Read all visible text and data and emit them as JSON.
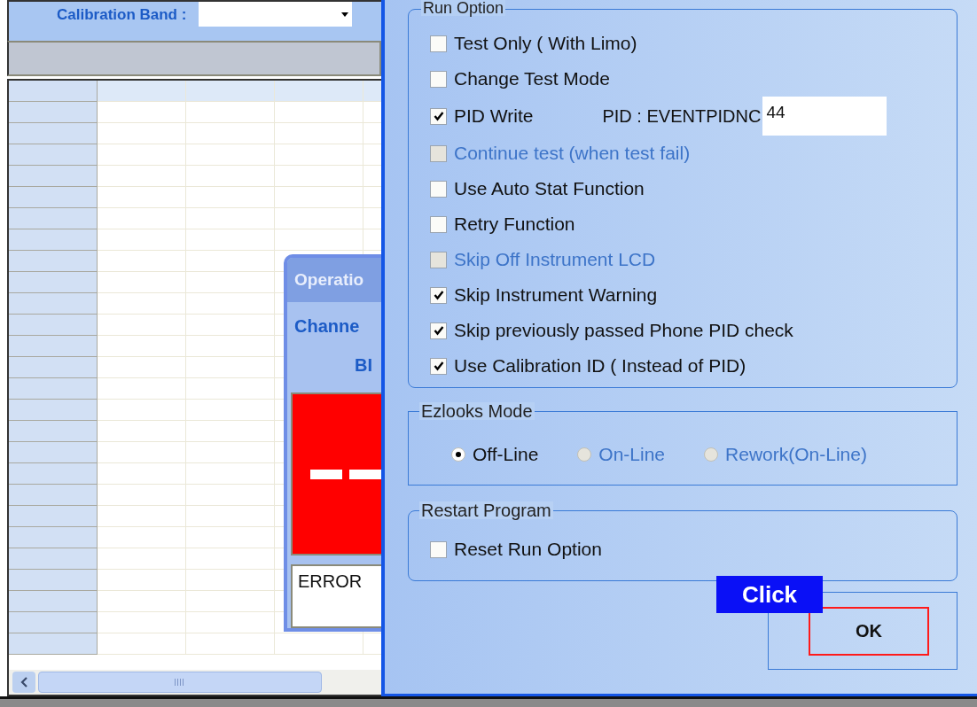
{
  "background_app": {
    "calibration_band": {
      "label": "Calibration Band :"
    }
  },
  "operation_window": {
    "title": "Operatio",
    "channel_label": "Channe",
    "band_label": "BI",
    "message": "ERROR"
  },
  "dialog": {
    "run_option": {
      "title": "Run Option",
      "options": [
        {
          "label": "Test Only ( With Limo)",
          "checked": false,
          "disabled": false
        },
        {
          "label": "Change Test Mode",
          "checked": false,
          "disabled": false
        },
        {
          "label": "PID Write",
          "checked": true,
          "disabled": false,
          "pid": {
            "label": "PID :  EVENTPIDNC",
            "value": "44"
          }
        },
        {
          "label": "Continue test (when test fail)",
          "checked": false,
          "disabled": true
        },
        {
          "label": "Use Auto Stat Function",
          "checked": false,
          "disabled": false
        },
        {
          "label": "Retry Function",
          "checked": false,
          "disabled": false
        },
        {
          "label": "Skip Off Instrument LCD",
          "checked": false,
          "disabled": true
        },
        {
          "label": "Skip Instrument Warning",
          "checked": true,
          "disabled": false
        },
        {
          "label": "Skip previously passed Phone PID check",
          "checked": true,
          "disabled": false
        },
        {
          "label": "Use Calibration ID ( Instead of PID)",
          "checked": true,
          "disabled": false
        }
      ]
    },
    "ezlooks_mode": {
      "title": "Ezlooks Mode",
      "options": [
        {
          "label": "Off-Line",
          "selected": true,
          "disabled": false
        },
        {
          "label": "On-Line",
          "selected": false,
          "disabled": true
        },
        {
          "label": "Rework(On-Line)",
          "selected": false,
          "disabled": true
        }
      ]
    },
    "restart_program": {
      "title": "Restart Program",
      "options": [
        {
          "label": "Reset Run Option",
          "checked": false,
          "disabled": false
        }
      ]
    },
    "ok_button": "OK",
    "callout": "Click"
  }
}
